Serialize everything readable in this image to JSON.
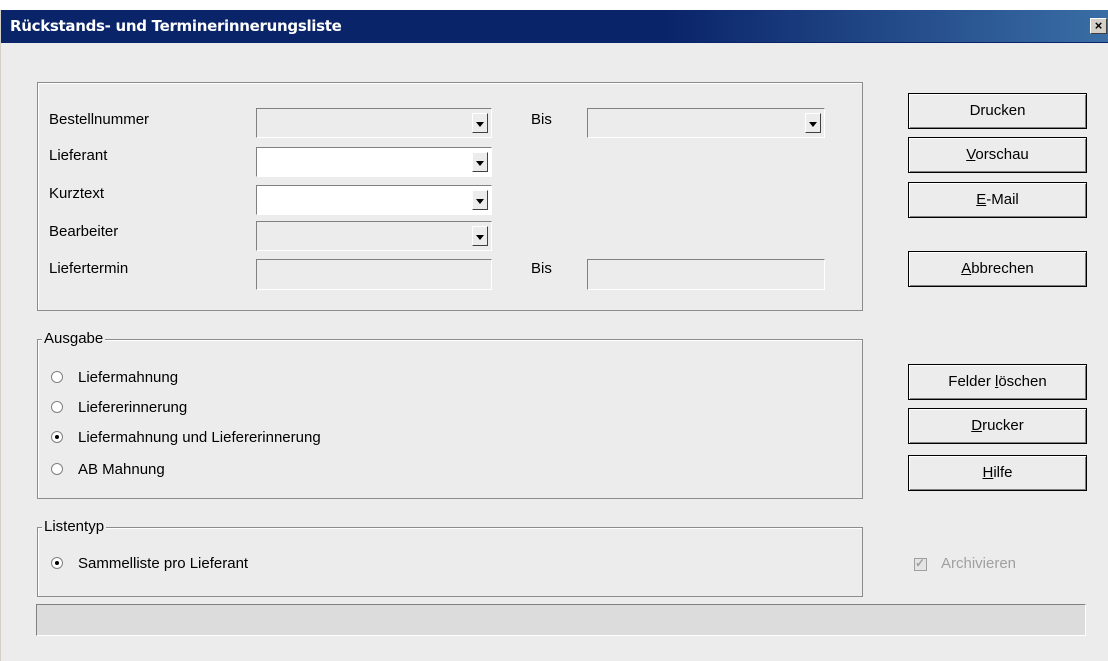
{
  "window": {
    "title": "Rückstands- und Terminerinnerungsliste",
    "close_label": "×"
  },
  "filter": {
    "bestellnummer_label": "Bestellnummer",
    "bestellnummer_bis_label": "Bis",
    "lieferant_label": "Lieferant",
    "kurztext_label": "Kurztext",
    "bearbeiter_label": "Bearbeiter",
    "liefertermin_label": "Liefertermin",
    "liefertermin_bis_label": "Bis"
  },
  "buttons": {
    "drucken": "Drucken",
    "vorschau_hotkey": "V",
    "vorschau_rest": "orschau",
    "email_hotkey": "E",
    "email_rest": "-Mail",
    "abbrechen_hotkey": "A",
    "abbrechen_rest": "bbrechen",
    "felder_prefix": "Felder ",
    "felder_hotkey": "l",
    "felder_rest": "öschen",
    "drucker_hotkey": "D",
    "drucker_rest": "rucker",
    "hilfe_hotkey": "H",
    "hilfe_rest": "ilfe"
  },
  "ausgabe": {
    "legend": "Ausgabe",
    "options": [
      {
        "label": "Liefermahnung",
        "checked": false
      },
      {
        "label": "Liefererinnerung",
        "checked": false
      },
      {
        "label": "Liefermahnung und Liefererinnerung",
        "checked": true
      },
      {
        "label": "AB Mahnung",
        "checked": false
      }
    ]
  },
  "listentyp": {
    "legend": "Listentyp",
    "options": [
      {
        "label": "Sammelliste pro Lieferant",
        "checked": true
      }
    ]
  },
  "archivieren": {
    "label": "Archivieren",
    "checked": true,
    "enabled": false
  }
}
